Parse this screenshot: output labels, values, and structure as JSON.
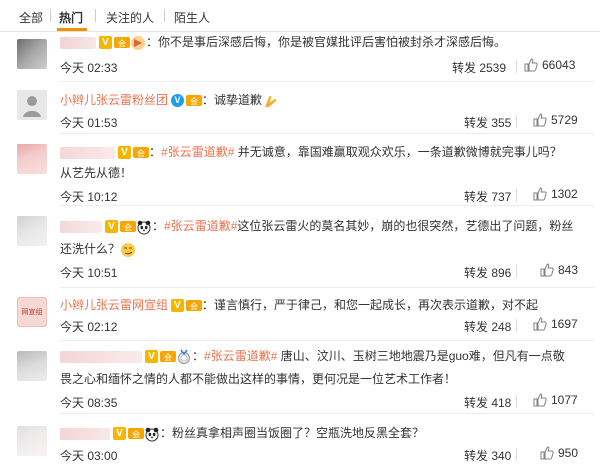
{
  "tabs": [
    "全部",
    "热门",
    "关注的人",
    "陌生人"
  ],
  "colors": {
    "accent": "#f29100",
    "link": "#eb7350",
    "text": "#333333"
  },
  "comments": [
    {
      "name": "",
      "text": "你不是事后深感后悔，你是被官媒批评后害怕被封杀才深感后悔。",
      "time": "今天 02:33",
      "repost": "转发 2539",
      "likes": "66043"
    },
    {
      "name": "小辫儿张云雷粉丝团",
      "text": "诚挚道歉",
      "time": "今天 01:53",
      "repost": "转发 355",
      "likes": "5729"
    },
    {
      "name": "",
      "hashtag": "#张云雷道歉#",
      "text": " 并无诚意，靠国难赢取观众欢乐，一条道歉微博就完事儿吗？",
      "text2": "从艺先从德！",
      "time": "今天 10:12",
      "repost": "转发 737",
      "likes": "1302"
    },
    {
      "name": "",
      "hashtag": "#张云雷道歉#",
      "text": "这位张云雷火的莫名其妙，崩的也很突然，艺德出了问题，粉丝",
      "text2": "还洗什么？",
      "time": "今天 10:51",
      "repost": "转发 896",
      "likes": "843"
    },
    {
      "name": "小辫儿张云雷网宣组",
      "text": "谨言慎行，严于律己，和您一起成长，再次表示道歉，对不起",
      "avatar_text": "网宣组",
      "time": "今天 02:12",
      "repost": "转发 248",
      "likes": "1697"
    },
    {
      "name": "",
      "hashtag": "#张云雷道歉#",
      "text": " 唐山、汶川、玉树三地地震乃是guo难，但凡有一点敬",
      "text2": "畏之心和缅怀之情的人都不能做出这样的事情，更何况是一位艺术工作者！",
      "time": "今天 08:35",
      "repost": "转发 418",
      "likes": "1077"
    },
    {
      "name": "",
      "text": "粉丝真拿相声圈当饭圈了？空瓶洗地反黑全套？",
      "time": "今天 03:00",
      "repost": "转发 340",
      "likes": "950"
    }
  ]
}
